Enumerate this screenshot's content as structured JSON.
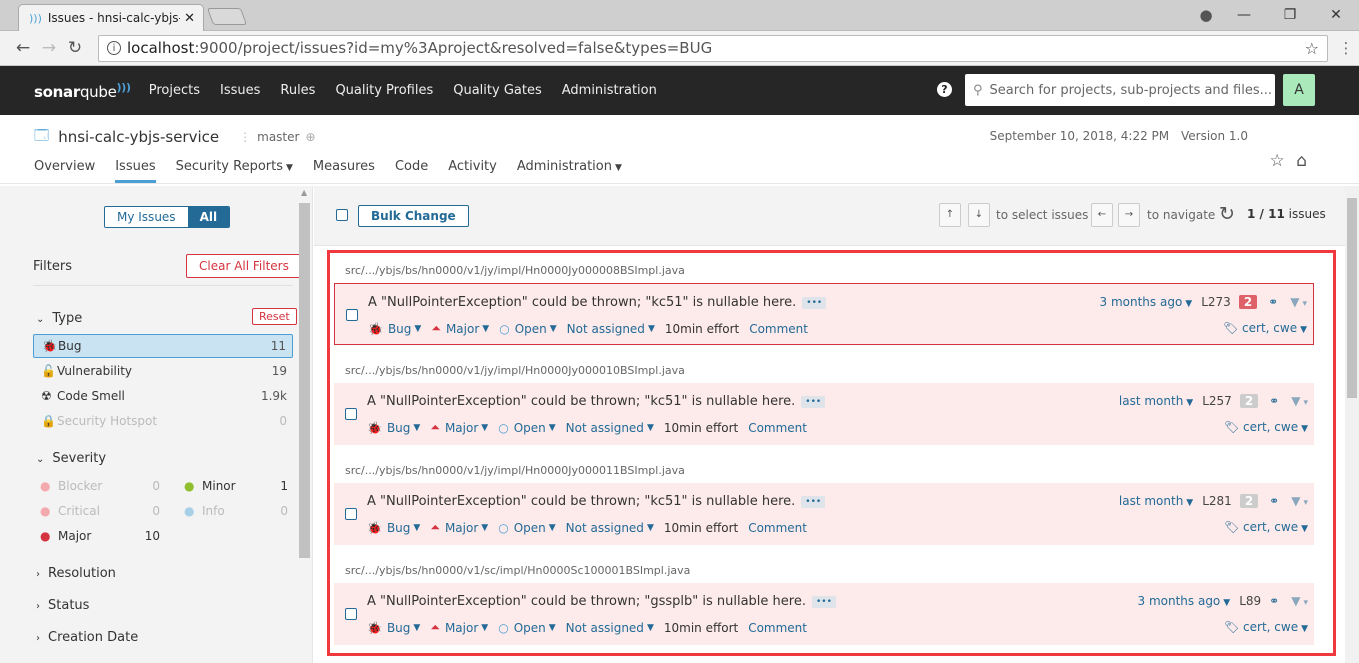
{
  "browser": {
    "tab_title": "Issues - hnsi-calc-ybjs-s",
    "url_host": "localhost",
    "url_rest": ":9000/project/issues?id=my%3Aproject&resolved=false&types=BUG"
  },
  "topnav": {
    "logo_bold": "sonar",
    "logo_light": "qube",
    "links": [
      "Projects",
      "Issues",
      "Rules",
      "Quality Profiles",
      "Quality Gates",
      "Administration"
    ],
    "search_placeholder": "Search for projects, sub-projects and files...",
    "avatar": "A"
  },
  "project": {
    "name": "hnsi-calc-ybjs-service",
    "branch": "master",
    "date": "September 10, 2018, 4:22 PM",
    "version": "Version 1.0",
    "tabs": [
      "Overview",
      "Issues",
      "Security Reports",
      "Measures",
      "Code",
      "Activity",
      "Administration"
    ]
  },
  "sidebar": {
    "my_issues": "My Issues",
    "all": "All",
    "filters_title": "Filters",
    "clear_all": "Clear All Filters",
    "type": {
      "title": "Type",
      "reset": "Reset",
      "items": [
        {
          "label": "Bug",
          "count": "11"
        },
        {
          "label": "Vulnerability",
          "count": "19"
        },
        {
          "label": "Code Smell",
          "count": "1.9k"
        },
        {
          "label": "Security Hotspot",
          "count": "0"
        }
      ]
    },
    "severity": {
      "title": "Severity",
      "items": [
        {
          "label": "Blocker",
          "count": "0"
        },
        {
          "label": "Minor",
          "count": "1"
        },
        {
          "label": "Critical",
          "count": "0"
        },
        {
          "label": "Info",
          "count": "0"
        },
        {
          "label": "Major",
          "count": "10"
        }
      ]
    },
    "collapsed": [
      "Resolution",
      "Status",
      "Creation Date"
    ]
  },
  "toolbar": {
    "bulk_change": "Bulk Change",
    "select_hint": "to select issues",
    "navigate_hint": "to navigate",
    "current": "1 / 11",
    "issues_label": "issues"
  },
  "issues": [
    {
      "component": "src/.../ybjs/bs/hn0000/v1/jy/impl/Hn0000Jy000008BSImpl.java",
      "message": "A \"NullPointerException\" could be thrown; \"kc51\" is nullable here.",
      "type": "Bug",
      "severity": "Major",
      "status": "Open",
      "assignee": "Not assigned",
      "effort": "10min effort",
      "comment": "Comment",
      "date": "3 months ago",
      "line": "L273",
      "flows": "2",
      "tags": "cert, cwe"
    },
    {
      "component": "src/.../ybjs/bs/hn0000/v1/jy/impl/Hn0000Jy000010BSImpl.java",
      "message": "A \"NullPointerException\" could be thrown; \"kc51\" is nullable here.",
      "type": "Bug",
      "severity": "Major",
      "status": "Open",
      "assignee": "Not assigned",
      "effort": "10min effort",
      "comment": "Comment",
      "date": "last month",
      "line": "L257",
      "flows": "2",
      "tags": "cert, cwe"
    },
    {
      "component": "src/.../ybjs/bs/hn0000/v1/jy/impl/Hn0000Jy000011BSImpl.java",
      "message": "A \"NullPointerException\" could be thrown; \"kc51\" is nullable here.",
      "type": "Bug",
      "severity": "Major",
      "status": "Open",
      "assignee": "Not assigned",
      "effort": "10min effort",
      "comment": "Comment",
      "date": "last month",
      "line": "L281",
      "flows": "2",
      "tags": "cert, cwe"
    },
    {
      "component": "src/.../ybjs/bs/hn0000/v1/sc/impl/Hn0000Sc100001BSImpl.java",
      "message": "A \"NullPointerException\" could be thrown; \"gssplb\" is nullable here.",
      "type": "Bug",
      "severity": "Major",
      "status": "Open",
      "assignee": "Not assigned",
      "effort": "10min effort",
      "comment": "Comment",
      "date": "3 months ago",
      "line": "L89",
      "flows": "",
      "tags": "cert, cwe"
    }
  ],
  "colors": {
    "accent": "#236a97",
    "danger": "#d4333f",
    "highlight_box": "#f0393e",
    "issue_bg": "#fdeaea"
  }
}
